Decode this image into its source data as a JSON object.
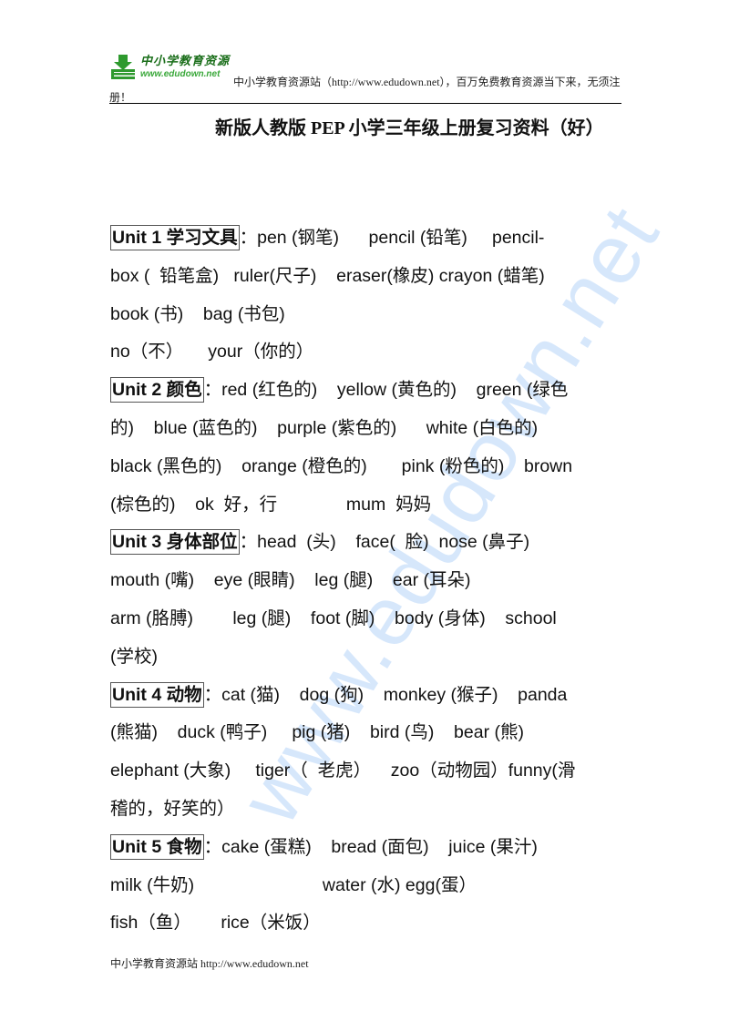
{
  "header": {
    "logo_cn": "中小学教育资源",
    "logo_url": "www.edudown.net",
    "text": "中小学教育资源站（http://www.edudown.net），百万免费教育资源当下来，无须注",
    "text_wrap": "册！"
  },
  "title": "新版人教版 PEP 小学三年级上册复习资料（好）",
  "watermark": "www.edudown.net",
  "units": [
    {
      "label": "Unit 1 学习文具",
      "lines": [
        "：pen (钢笔)      pencil (铅笔)     pencil-",
        "box (  铅笔盒)   ruler(尺子)    eraser(橡皮) crayon (蜡笔)",
        "book (书)    bag (书包)",
        "no（不）     your（你的）"
      ]
    },
    {
      "label": "Unit 2 颜色",
      "lines": [
        "：red (红色的)    yellow (黄色的)    green (绿色",
        "的)    blue (蓝色的)    purple (紫色的)      white (白色的)",
        "black (黑色的)    orange (橙色的)       pink (粉色的)    brown",
        "(棕色的)    ok  好，行              mum  妈妈"
      ]
    },
    {
      "label": "Unit 3 身体部位",
      "lines": [
        "：head  (头)    face(  脸)  nose (鼻子)",
        "mouth (嘴)    eye (眼睛)    leg (腿)    ear (耳朵)",
        "arm (胳膊)        leg (腿)    foot (脚)    body (身体)    school",
        "(学校)"
      ]
    },
    {
      "label": "Unit 4 动物",
      "lines": [
        "：cat (猫)    dog (狗)    monkey (猴子)    panda",
        "(熊猫)    duck (鸭子)     pig (猪)    bird (鸟)    bear (熊)",
        "elephant (大象)     tiger（  老虎）    zoo（动物园）funny(滑",
        "稽的，好笑的）"
      ]
    },
    {
      "label": "Unit 5 食物",
      "lines": [
        "：cake (蛋糕)    bread (面包)    juice (果汁)",
        "milk (牛奶)                          water (水) egg(蛋）",
        "fish（鱼）      rice（米饭）"
      ]
    }
  ],
  "footer": "中小学教育资源站 http://www.edudown.net",
  "colors": {
    "logo_green": "#2e9a2e",
    "watermark_blue": "#cfe3fb"
  }
}
